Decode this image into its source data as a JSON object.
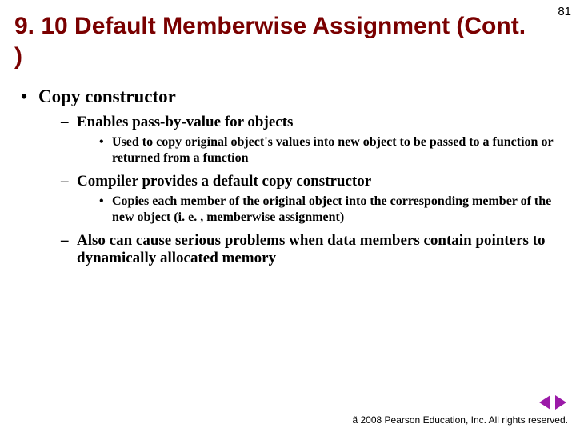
{
  "page_number": "81",
  "title": "9. 10 Default Memberwise Assignment (Cont. )",
  "bullets": {
    "l1": {
      "item0": {
        "text": "Copy constructor",
        "l2": {
          "item0": {
            "text": "Enables pass-by-value for objects",
            "l3": {
              "item0": "Used to copy original object's values into new object to be passed to a function or returned from a function"
            }
          },
          "item1": {
            "text": "Compiler provides a default copy constructor",
            "l3": {
              "item0": "Copies each member of the original object into the corresponding member of the new object (i. e. , memberwise assignment)"
            }
          },
          "item2": {
            "text": "Also can cause serious problems when data members contain pointers to dynamically allocated memory"
          }
        }
      }
    }
  },
  "footer": "ã 2008 Pearson Education, Inc. All rights reserved.",
  "nav": {
    "prev": "previous-slide",
    "next": "next-slide"
  }
}
